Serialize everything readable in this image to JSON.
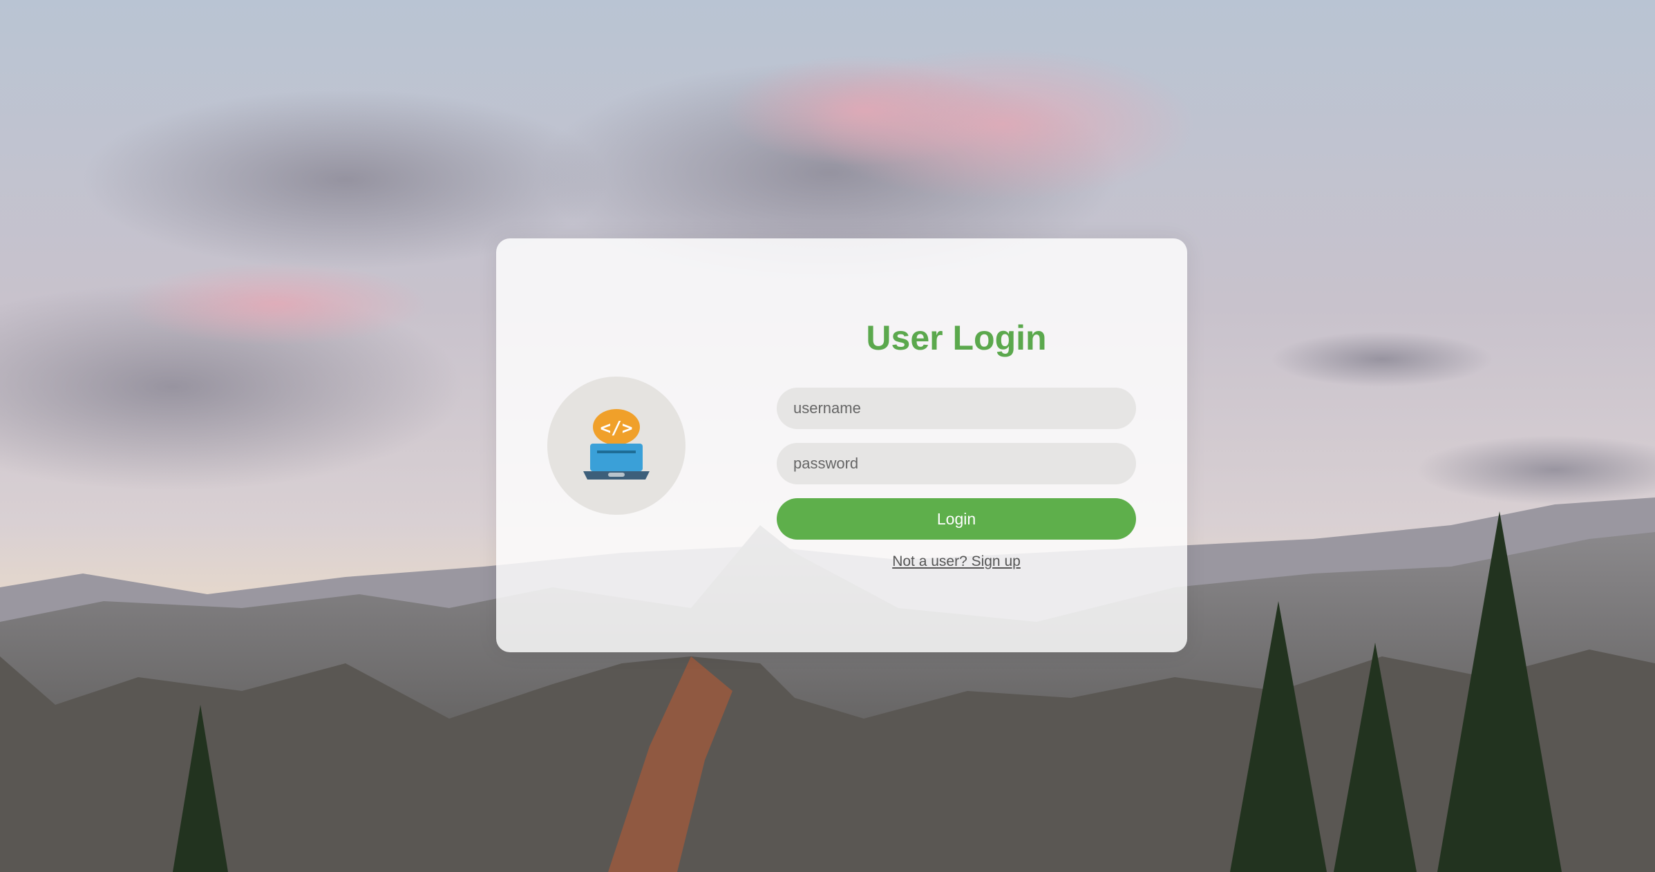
{
  "login": {
    "title": "User Login",
    "username_placeholder": "username",
    "password_placeholder": "password",
    "button_label": "Login",
    "signup_link": "Not a user? Sign up"
  },
  "colors": {
    "accent_green": "#5eaf4b",
    "title_green": "#5ba84d",
    "field_bg": "#e6e5e4",
    "avatar_bg": "#e5e3e0"
  },
  "icons": {
    "avatar": "laptop-code-icon"
  }
}
